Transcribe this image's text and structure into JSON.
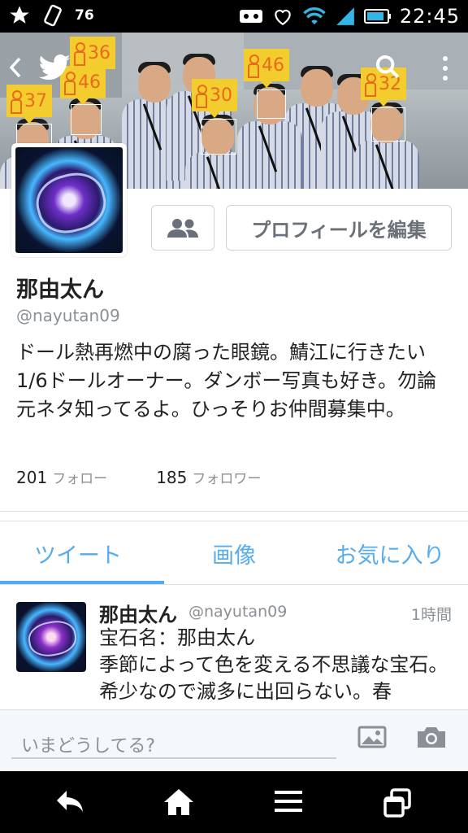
{
  "status_bar": {
    "battery_percent": "76",
    "time": "22:45"
  },
  "header_photo": {
    "age_tags": [
      "37",
      "36",
      "46",
      "30",
      "46",
      "32"
    ]
  },
  "profile": {
    "name": "那由太ん",
    "handle": "@nayutan09",
    "edit_button_label": "プロフィールを編集",
    "bio": "ドール熱再燃中の腐った眼鏡。鯖江に行きたい1/6ドールオーナー。ダンボー写真も好き。勿論元ネタ知ってるよ。ひっそりお仲間募集中。",
    "following_count": "201",
    "following_label": "フォロー",
    "followers_count": "185",
    "followers_label": "フォロワー"
  },
  "tabs": [
    {
      "label": "ツイート",
      "selected": true
    },
    {
      "label": "画像",
      "selected": false
    },
    {
      "label": "お気に入り",
      "selected": false
    }
  ],
  "tweet": {
    "name": "那由太ん",
    "handle": "@nayutan09",
    "time": "1時間",
    "text": "宝石名：那由太ん\n季節によって色を変える不思議な宝石。希少なので滅多に出回らない。春"
  },
  "compose": {
    "placeholder": "いまどうしてる?"
  },
  "colors": {
    "accent": "#55acee",
    "age_tag": "#f2cd2d"
  }
}
